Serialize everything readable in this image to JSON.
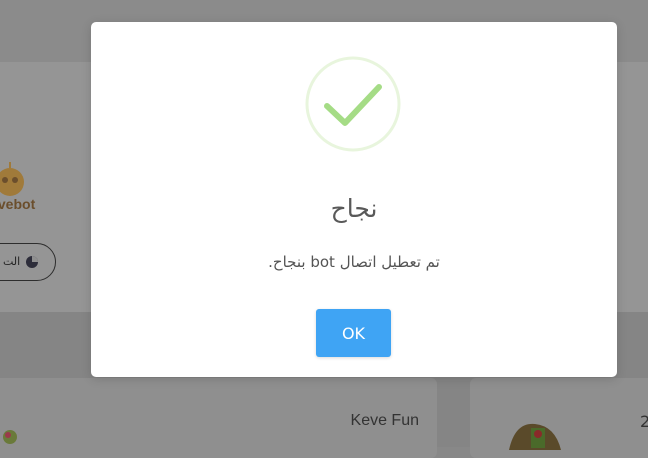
{
  "modal": {
    "title": "نجاح",
    "message": "تم تعطيل اتصال bot بنجاح.",
    "ok_label": "OK",
    "icon": "success-check-icon"
  },
  "background": {
    "logo_text": "ivebot",
    "pill_label": "الت",
    "card_title": "Keve Fun",
    "right_card_digit": "2"
  },
  "colors": {
    "success": "#a5dc86",
    "button": "#3fa4f4",
    "overlay": "#888888"
  }
}
